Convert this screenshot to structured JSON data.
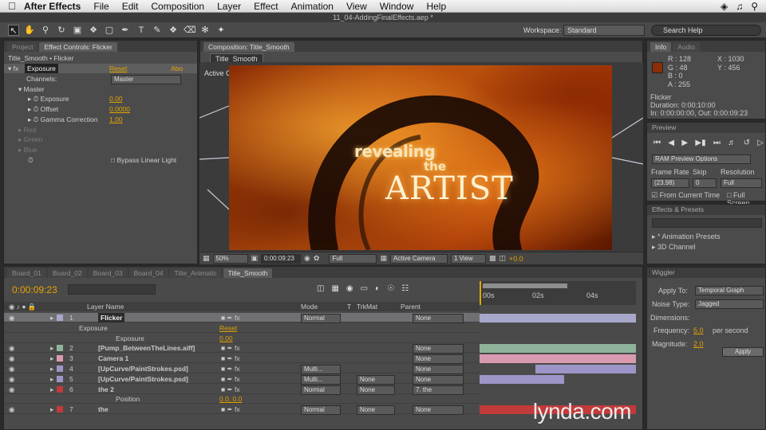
{
  "menubar": {
    "app_name": "After Effects",
    "items": [
      "File",
      "Edit",
      "Composition",
      "Layer",
      "Effect",
      "Animation",
      "View",
      "Window",
      "Help"
    ]
  },
  "window_title": "11_04-AddingFinalEffects.aep *",
  "workspace": {
    "label": "Workspace:",
    "value": "Standard"
  },
  "search_help": "Search Help",
  "left_panel": {
    "tabs": [
      "Project",
      "Effect Controls: Flicker"
    ],
    "breadcrumb": "Title_Smooth • Flicker",
    "effect_name": "Exposure",
    "reset": "Reset",
    "about": "Abo",
    "channels_label": "Channels:",
    "channels_value": "Master",
    "master_label": "Master",
    "exposure_label": "Exposure",
    "exposure_value": "0.00",
    "offset_label": "Offset",
    "offset_value": "0.0000",
    "gamma_label": "Gamma Correction",
    "gamma_value": "1.00",
    "red": "Red",
    "green": "Green",
    "blue": "Blue",
    "bypass": "Bypass Linear Light"
  },
  "composition": {
    "tab": "Composition: Title_Smooth",
    "sub_tab": "Title_Smooth",
    "camera_label": "Active Camera",
    "text_revealing": "revealing",
    "text_the": "the",
    "text_artist": "ARTIST",
    "zoom": "50%",
    "timecode": "0:00:09:23",
    "resolution": "Full",
    "view": "Active Camera",
    "views": "1 View",
    "offset": "+0.0"
  },
  "info": {
    "tabs": [
      "Info",
      "Audio"
    ],
    "r": "R : 128",
    "g": "G : 48",
    "b": "B : 0",
    "a": "A : 255",
    "x": "X : 1030",
    "y": "Y : 456",
    "swatch": "#8a2e05",
    "layer": "Flicker",
    "duration": "Duration: 0:00:10:00",
    "inout": "In: 0:00:00:00, Out: 0:00:09:23"
  },
  "preview": {
    "title": "Preview",
    "ram": "RAM Preview Options",
    "frame_rate_label": "Frame Rate",
    "frame_rate": "(23.98)",
    "skip_label": "Skip",
    "skip": "0",
    "resolution_label": "Resolution",
    "resolution": "Full",
    "from_current": "From Current Time",
    "full_screen": "Full Screen"
  },
  "effects_presets": {
    "title": "Effects & Presets",
    "items": [
      "* Animation Presets",
      "3D Channel"
    ]
  },
  "wiggler": {
    "title": "Wiggler",
    "apply_to_label": "Apply To:",
    "apply_to": "Temporal Graph",
    "noise_label": "Noise Type:",
    "noise": "Jagged",
    "dimensions_label": "Dimensions:",
    "frequency_label": "Frequency:",
    "frequency": "5.0",
    "frequency_unit": "per second",
    "magnitude_label": "Magnitude:",
    "magnitude": "2.0",
    "apply": "Apply"
  },
  "timeline": {
    "tabs": [
      "Board_01",
      "Board_02",
      "Board_03",
      "Board_04",
      "Title_Animatic",
      "Title_Smooth"
    ],
    "timecode": "0:00:09:23",
    "headers": {
      "layer_name": "Layer Name",
      "mode": "Mode",
      "t": "T",
      "trkmat": "TrkMat",
      "parent": "Parent"
    },
    "ruler": [
      "00s",
      "02s",
      "04s"
    ],
    "rows": [
      {
        "num": "1",
        "name": "Flicker",
        "mode": "Normal",
        "trkmat": "",
        "parent": "None",
        "color": "#a7a7c9"
      },
      {
        "num": "",
        "name": "Exposure",
        "mode": "",
        "trkmat": "",
        "parent": "",
        "reset": "Reset",
        "color": ""
      },
      {
        "num": "",
        "name": "Exposure",
        "mode": "",
        "trkmat": "",
        "parent": "",
        "value": "0.00",
        "color": ""
      },
      {
        "num": "2",
        "name": "[Pump_BetweenTheLines.aiff]",
        "mode": "",
        "trkmat": "",
        "parent": "None",
        "color": "#8fb39a"
      },
      {
        "num": "3",
        "name": "Camera 1",
        "mode": "",
        "trkmat": "",
        "parent": "None",
        "color": "#d99ab0"
      },
      {
        "num": "4",
        "name": "[UpCurve/PaintStrokes.psd]",
        "mode": "Multi...",
        "trkmat": "",
        "parent": "None",
        "color": "#9d95c7"
      },
      {
        "num": "5",
        "name": "[UpCurve/PaintStrokes.psd]",
        "mode": "Multi...",
        "trkmat": "None",
        "parent": "None",
        "color": "#9d95c7"
      },
      {
        "num": "6",
        "name": "the 2",
        "mode": "Normal",
        "trkmat": "None",
        "parent": "7. the",
        "color": "#c23a3a"
      },
      {
        "num": "",
        "name": "Position",
        "mode": "",
        "trkmat": "",
        "parent": "",
        "value": "0.0, 0.0",
        "color": ""
      },
      {
        "num": "7",
        "name": "the",
        "mode": "Normal",
        "trkmat": "None",
        "parent": "None",
        "color": "#c23a3a"
      }
    ]
  },
  "watermark": "lynda.com"
}
